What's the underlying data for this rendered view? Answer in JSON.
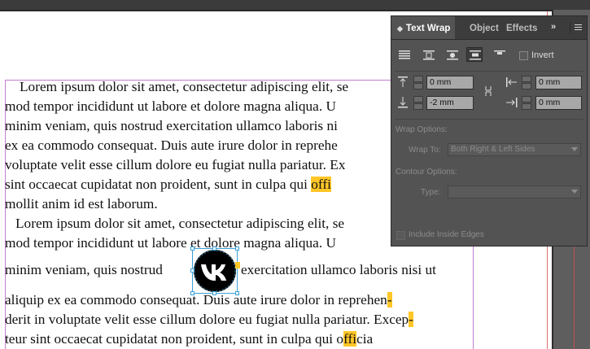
{
  "document": {
    "para1": [
      "Lorem ipsum dolor sit amet, consectetur adipiscing elit, se",
      "mod tempor incididunt ut labore et dolore magna aliqua. U",
      "minim veniam, quis nostrud exercitation ullamco laboris ni",
      "ex ea commodo consequat. Duis aute irure dolor in reprehe",
      "voluptate velit esse cillum dolore eu fugiat nulla pariatur. Ex",
      "sint occaecat cupidatat non proident, sunt in culpa qui ",
      "mollit anim id est laborum."
    ],
    "para1_line6_hl": "offi",
    "para2": [
      "Lorem ipsum dolor sit amet, consectetur adipiscing elit, se",
      "mod tempor incididunt ut labore et dolore magna aliqua. U"
    ],
    "wrap_left": "minim veniam, quis nostrud",
    "wrap_right": "exercitation ullamco laboris nisi ut",
    "para2_after": [
      "aliquip ex ea commodo consequat. Duis aute irure dolor in reprehen",
      "derit in voluptate velit esse cillum dolore eu fugiat nulla pariatur. Excep",
      "teur sint occaecat cupidatat non proident, sunt in culpa qui o"
    ],
    "hyphen": "-",
    "last_hl": "ffi",
    "last_tail": "cia"
  },
  "graphic": {
    "icon": "vk-logo-icon"
  },
  "panel": {
    "tabs": [
      "Text Wrap",
      "Object",
      "Effects"
    ],
    "active_tab": "Text Wrap",
    "more": "»",
    "invert_label": "Invert",
    "top_offset": "0 mm",
    "bottom_offset": "-2 mm",
    "left_offset": "0 mm",
    "right_offset": "0 mm",
    "wrap_options_label": "Wrap Options:",
    "wrap_to_label": "Wrap To:",
    "wrap_to_value": "Both Right & Left Sides",
    "contour_options_label": "Contour Options:",
    "type_label": "Type:",
    "type_value": "",
    "include_inside_edges_label": "Include Inside Edges"
  }
}
